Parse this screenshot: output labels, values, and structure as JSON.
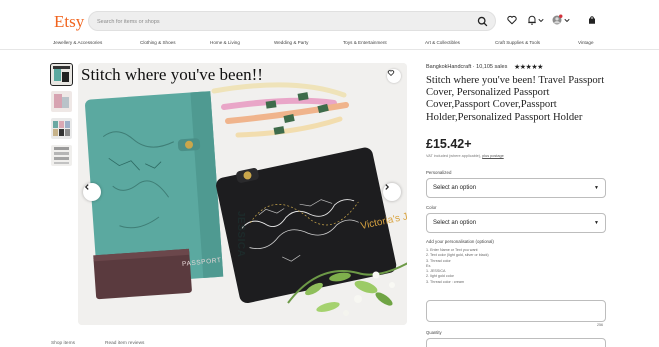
{
  "header": {
    "logo": "Etsy",
    "search_placeholder": "Search for items or shops",
    "icons": [
      "search-icon",
      "heart-icon",
      "bell-icon",
      "avatar",
      "cart-icon"
    ]
  },
  "nav": {
    "items": [
      "Jewellery & Accessories",
      "Clothing & Shoes",
      "Home & Living",
      "Wedding & Party",
      "Toys & Entertainment",
      "Art & Collectibles",
      "Craft Supplies & Tools",
      "Vintage"
    ]
  },
  "gallery": {
    "caption": "Stitch where you've been!!",
    "spine_text": "JESSICA",
    "passport_text": "PASSPORT",
    "journey_text": "Victoria's Journey"
  },
  "below_image": {
    "tabs": [
      "Shop items",
      "Read item reviews"
    ]
  },
  "product": {
    "shop_name": "BangkokHandcraft",
    "sales": "10,105 sales",
    "rating_stars": "★★★★★",
    "rating": 5,
    "title": "Stitch where you've been! Travel Passport Cover, Personalized Passport Cover,Passport Cover,Passport Holder,Personalized Passport Holder",
    "price": "£15.42+",
    "vat_note": "VAT included (where applicable),",
    "vat_link": "plus postage",
    "personalized_label": "Personalized",
    "personalized_value": "Select an option",
    "color_label": "Color",
    "color_value": "Select an option",
    "personalisation_label": "Add your personalisation (optional)",
    "instructions": [
      "1. Enter Name or Text you want",
      "2. Text color (light gold, silver or black)",
      "3. Thread color",
      "Ex.",
      "1. JESSICA",
      "2. light gold color",
      "3. Thread color : cream"
    ],
    "char_count": "256",
    "quantity_label": "Quantity"
  },
  "colors": {
    "etsy_orange": "#f1641e",
    "teal_cover": "#5ba9a0",
    "black_cover": "#1d1d1f",
    "thread_pink": "#e9a6c8",
    "thread_peach": "#f0b48c",
    "thread_green": "#3e6b4a"
  }
}
